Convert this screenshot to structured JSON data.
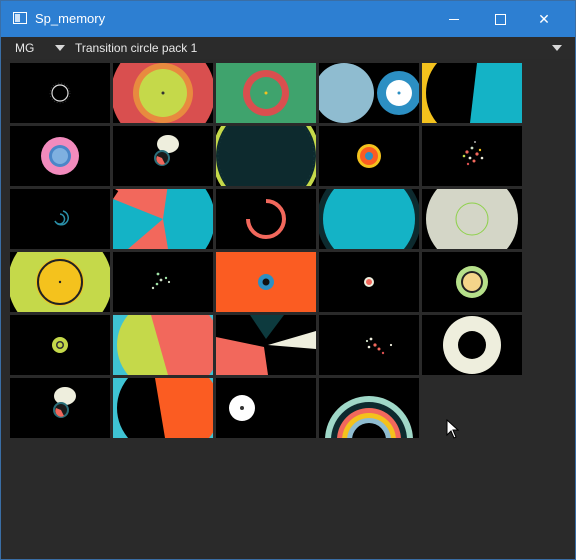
{
  "window": {
    "title": "Sp_memory"
  },
  "toolbar": {
    "category_value": "MG",
    "pack_value": "Transition circle pack 1"
  },
  "icons": {
    "app": "app-window-icon",
    "minimize": "minimize-icon",
    "maximize": "maximize-icon",
    "close": "close-icon",
    "dropdown": "chevron-down-icon",
    "cursor": "mouse-cursor-icon"
  },
  "colors": {
    "titlebar": "#2d7fd2",
    "window_bg": "#2a2a2a",
    "tile_bg": "#000000",
    "yellow": "#f4c21d",
    "teal": "#14b3c6",
    "coral": "#f2685c",
    "red": "#d94f4f",
    "lime": "#c5d94a",
    "orange": "#fb5c22",
    "cream": "#eeeedd",
    "blue": "#2c8fc3"
  },
  "thumbnails": [
    {
      "name": "thumb-small-ring"
    },
    {
      "name": "thumb-red-lime-circle"
    },
    {
      "name": "thumb-green-red-ring"
    },
    {
      "name": "thumb-blue-circles"
    },
    {
      "name": "thumb-yellow-teal-split"
    },
    {
      "name": "thumb-pink-blue-ring"
    },
    {
      "name": "thumb-blob-ring"
    },
    {
      "name": "thumb-dark-teal-circle"
    },
    {
      "name": "thumb-orange-dot"
    },
    {
      "name": "thumb-particles"
    },
    {
      "name": "thumb-teal-swirl"
    },
    {
      "name": "thumb-teal-coral-wedges"
    },
    {
      "name": "thumb-coral-arc"
    },
    {
      "name": "thumb-teal-large-circle"
    },
    {
      "name": "thumb-cream-green-ring"
    },
    {
      "name": "thumb-lime-yellow-ring"
    },
    {
      "name": "thumb-green-particles"
    },
    {
      "name": "thumb-orange-blue-dot"
    },
    {
      "name": "thumb-small-coral-dot"
    },
    {
      "name": "thumb-yellow-green-ring"
    },
    {
      "name": "thumb-lime-dot"
    },
    {
      "name": "thumb-lime-coral-split"
    },
    {
      "name": "thumb-coral-cream-shards"
    },
    {
      "name": "thumb-particles-2"
    },
    {
      "name": "thumb-cream-donut"
    },
    {
      "name": "thumb-blob-ring-2"
    },
    {
      "name": "thumb-teal-orange-split"
    },
    {
      "name": "thumb-white-dot"
    },
    {
      "name": "thumb-concentric-arcs"
    }
  ]
}
